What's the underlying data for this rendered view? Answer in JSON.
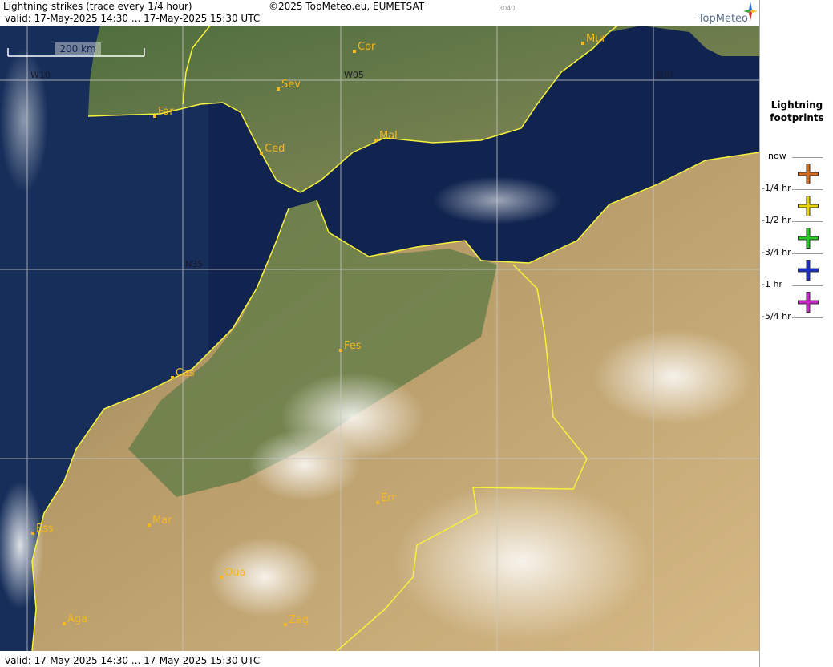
{
  "header": {
    "title": "Lightning strikes (trace every 1/4 hour)",
    "copyright": "©2025 TopMeteo.eu, EUMETSAT",
    "frame_id": "3040",
    "valid": "valid:  17-May-2025 14:30 ... 17-May-2025 15:30 UTC",
    "logo": "TopMeteo"
  },
  "footer": {
    "valid": "valid:  17-May-2025 14:30 ... 17-May-2025 15:30 UTC"
  },
  "map": {
    "scale_label": "200 km",
    "grid_labels": {
      "w10": "W10",
      "w05": "W05",
      "e00": "E00",
      "n35": "N35"
    },
    "cities": [
      {
        "label": "Cor"
      },
      {
        "label": "Mur"
      },
      {
        "label": "Sev"
      },
      {
        "label": "Far"
      },
      {
        "label": "Mal"
      },
      {
        "label": "Ced"
      },
      {
        "label": "Fes"
      },
      {
        "label": "Cas"
      },
      {
        "label": "Err"
      },
      {
        "label": "Mar"
      },
      {
        "label": "Ess"
      },
      {
        "label": "Oua"
      },
      {
        "label": "Aga"
      },
      {
        "label": "Zag"
      }
    ],
    "colors": {
      "sea": "#0f2350",
      "land_north": "#5c7a45",
      "land_south": "#c4a678",
      "border": "#f7f23a",
      "label": "#f5b820",
      "grid": "#c8c8c8"
    }
  },
  "legend": {
    "title_line1": "Lightning",
    "title_line2": "footprints",
    "items": [
      {
        "label": "now",
        "color": "#d2691e"
      },
      {
        "label": "-1/4 hr",
        "color": "#e6d200"
      },
      {
        "label": "-1/2 hr",
        "color": "#22cc22"
      },
      {
        "label": "-3/4 hr",
        "color": "#1a2ccc"
      },
      {
        "label": "-1 hr",
        "color": "#cc22cc"
      },
      {
        "label": "-5/4 hr"
      }
    ]
  }
}
